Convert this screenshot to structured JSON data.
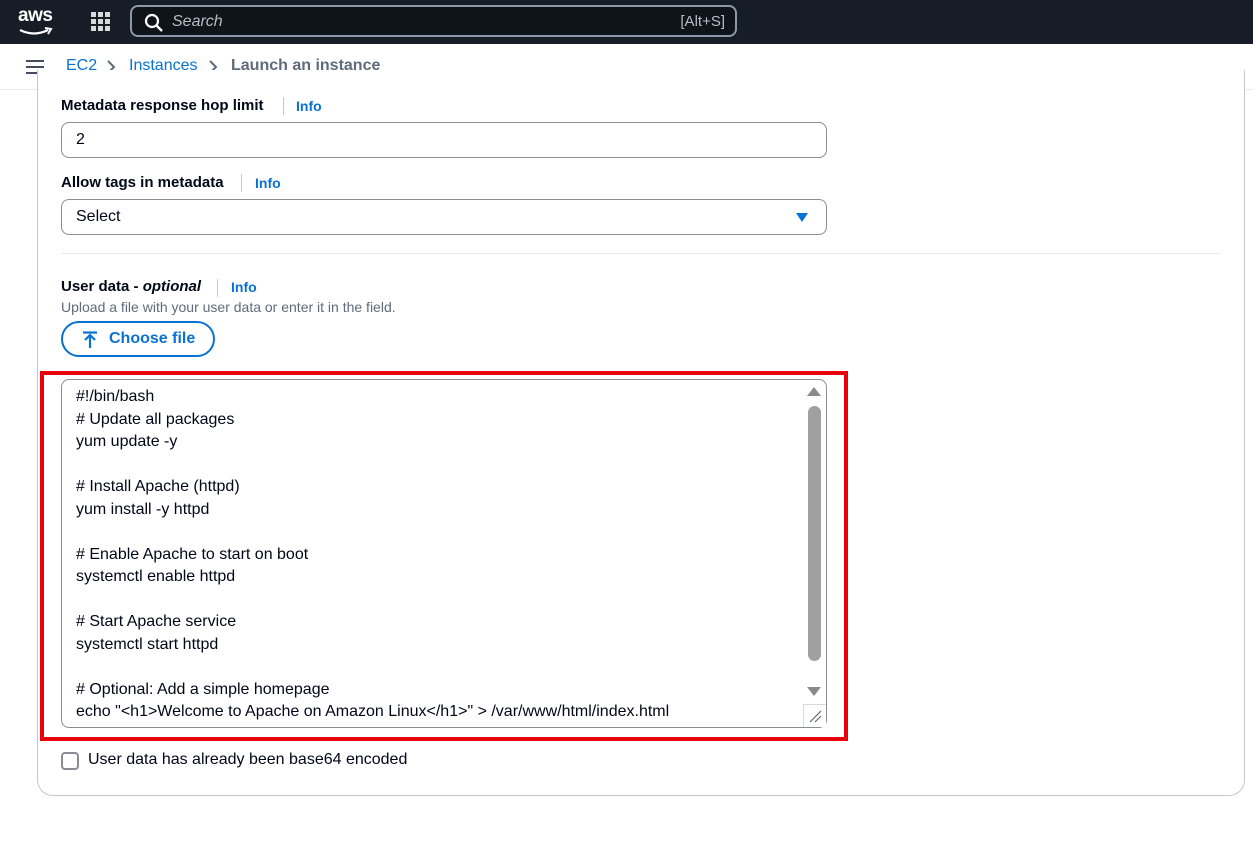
{
  "topnav": {
    "logo_text": "aws",
    "search_placeholder": "Search",
    "search_shortcut": "[Alt+S]"
  },
  "breadcrumb": {
    "items": [
      "EC2",
      "Instances"
    ],
    "current": "Launch an instance"
  },
  "form": {
    "hop_limit": {
      "label": "Metadata response hop limit",
      "info": "Info",
      "value": "2"
    },
    "allow_tags": {
      "label": "Allow tags in metadata",
      "info": "Info",
      "selected": "Select"
    },
    "user_data": {
      "label": "User data - ",
      "label_optional": "optional",
      "info": "Info",
      "description": "Upload a file with your user data or enter it in the field.",
      "choose_file_label": "Choose file",
      "content": "#!/bin/bash\n# Update all packages\nyum update -y\n\n# Install Apache (httpd)\nyum install -y httpd\n\n# Enable Apache to start on boot\nsystemctl enable httpd\n\n# Start Apache service\nsystemctl start httpd\n\n# Optional: Add a simple homepage\necho \"<h1>Welcome to Apache on Amazon Linux</h1>\" > /var/www/html/index.html",
      "base64_checkbox_label": "User data has already been base64 encoded",
      "base64_checked": false
    }
  },
  "colors": {
    "nav_bg": "#161d26",
    "link": "#0972d3",
    "highlight": "#e8000b"
  }
}
